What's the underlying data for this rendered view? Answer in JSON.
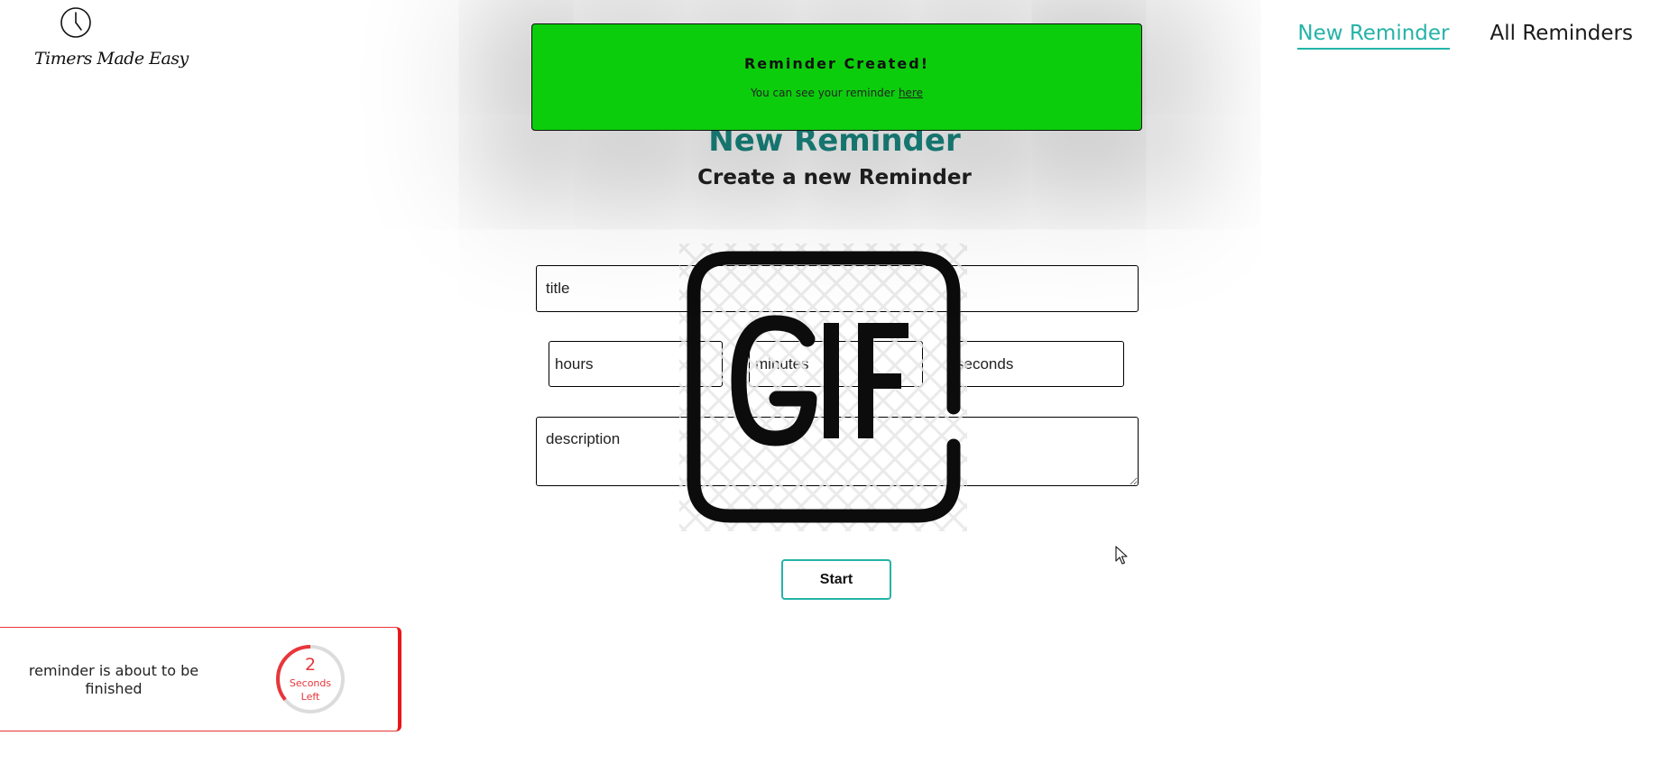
{
  "header": {
    "logo_text": "Timers Made Easy",
    "nav": {
      "new_reminder": "New Reminder",
      "all_reminders": "All Reminders"
    }
  },
  "main": {
    "title": "New Reminder",
    "subtitle": "Create a new Reminder"
  },
  "form": {
    "title_placeholder": "title",
    "hours_placeholder": "hours",
    "minutes_placeholder": "minutes",
    "seconds_placeholder": "seconds",
    "description_placeholder": "description",
    "start_label": "Start"
  },
  "toast": {
    "title": "Reminder Created!",
    "message_prefix": "You can see your reminder ",
    "link_text": "here"
  },
  "countdown": {
    "message": "reminder is about to be finished",
    "value": "2",
    "unit_line1": "Seconds",
    "unit_line2": "Left",
    "progress_fraction": 0.36
  },
  "colors": {
    "accent": "#24b3a8",
    "title": "#1a8a82",
    "toast_bg": "#0ccd0c",
    "countdown_red": "#e8363a"
  },
  "icons": {
    "logo": "clock-icon",
    "overlay": "gif-icon",
    "pointer": "mouse-cursor-icon"
  }
}
